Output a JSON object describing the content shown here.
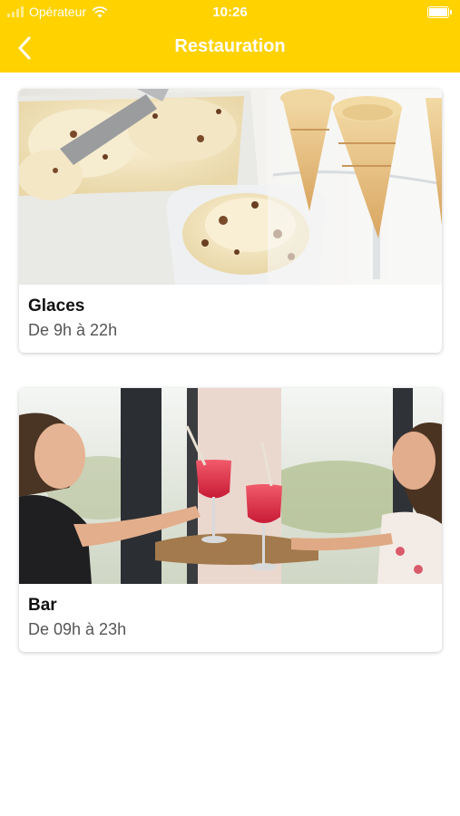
{
  "status_bar": {
    "carrier": "Opérateur",
    "time": "10:26"
  },
  "nav": {
    "title": "Restauration",
    "back_icon": "chevron-left-icon"
  },
  "colors": {
    "header": "#FFD200",
    "title_text": "#FFFFFF"
  },
  "items": [
    {
      "name": "Glaces",
      "hours": "De 9h à 22h",
      "image": "ice-cream-photo"
    },
    {
      "name": "Bar",
      "hours": "De 09h à 23h",
      "image": "cocktail-toast-photo"
    }
  ]
}
